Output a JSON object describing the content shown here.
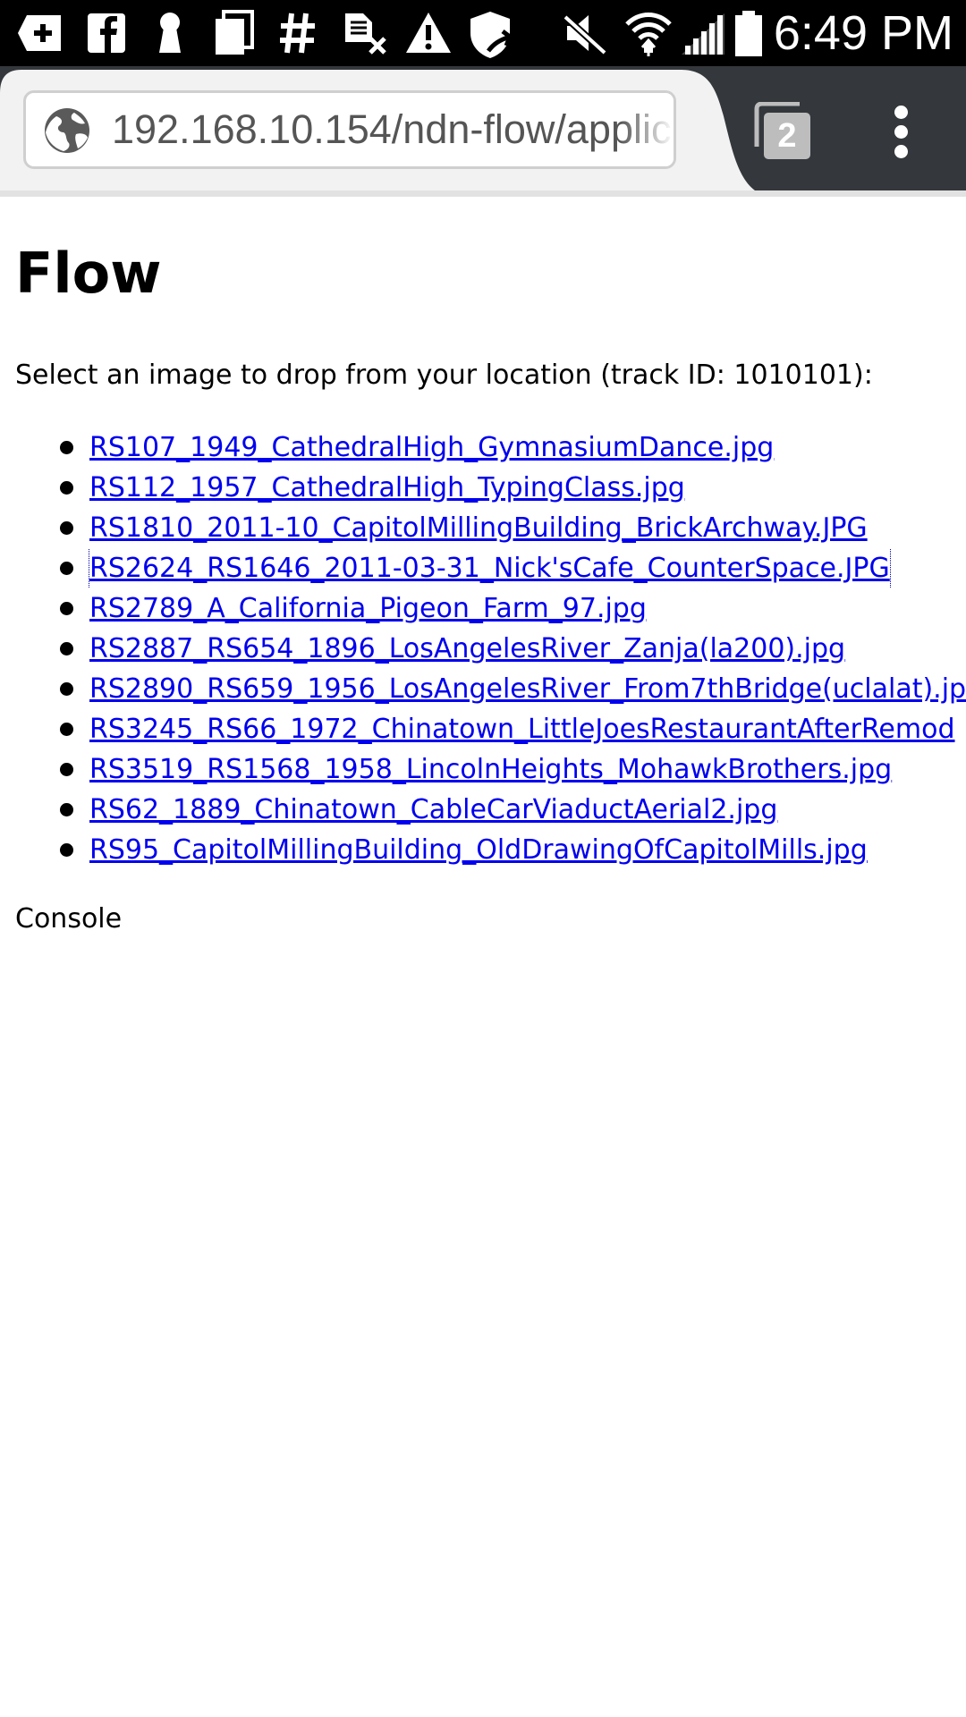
{
  "status_bar": {
    "time": "6:49 PM",
    "icons": [
      "add-box-icon",
      "facebook-icon",
      "keyhole-icon",
      "copy-icon",
      "hash-icon",
      "no-sim-icon",
      "warning-icon",
      "shield-icon",
      "mute-icon",
      "wifi-icon",
      "signal-icon",
      "battery-icon"
    ]
  },
  "browser": {
    "url": "192.168.10.154/ndn-flow/applic",
    "tab_count": "2"
  },
  "page": {
    "title": "Flow",
    "intro": "Select an image to drop from your location (track ID: 1010101):",
    "files": [
      "RS107_1949_CathedralHigh_GymnasiumDance.jpg",
      "RS112_1957_CathedralHigh_TypingClass.jpg",
      "RS1810_2011-10_CapitolMillingBuilding_BrickArchway.JPG",
      "RS2624_RS1646_2011-03-31_Nick'sCafe_CounterSpace.JPG",
      "RS2789_A_California_Pigeon_Farm_97.jpg",
      "RS2887_RS654_1896_LosAngelesRiver_Zanja(la200).jpg",
      "RS2890_RS659_1956_LosAngelesRiver_From7thBridge(uclalat).jp",
      "RS3245_RS66_1972_Chinatown_LittleJoesRestaurantAfterRemod",
      "RS3519_RS1568_1958_LincolnHeights_MohawkBrothers.jpg",
      "RS62_1889_Chinatown_CableCarViaductAerial2.jpg",
      "RS95_CapitolMillingBuilding_OldDrawingOfCapitolMills.jpg"
    ],
    "console_label": "Console"
  }
}
